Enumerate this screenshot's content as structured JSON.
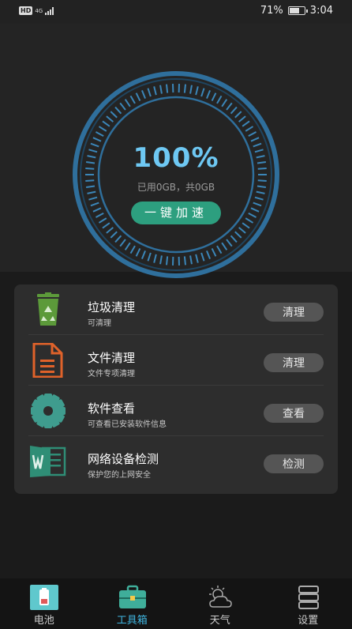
{
  "status_bar": {
    "hd": "HD",
    "network": "4G",
    "battery_text": "71%",
    "battery_level": 0.71,
    "time": "3:04"
  },
  "hero": {
    "percent": "100%",
    "usage": "已用0GB，共0GB",
    "boost_label": "一键加速"
  },
  "tools": [
    {
      "title": "垃圾清理",
      "desc": "可清理",
      "button": "清理",
      "icon": "trash-recycle-icon",
      "color": "#5c9a3a"
    },
    {
      "title": "文件清理",
      "desc": "文件专项清理",
      "button": "清理",
      "icon": "document-icon",
      "color": "#e0622a"
    },
    {
      "title": "软件查看",
      "desc": "可查看已安装软件信息",
      "button": "查看",
      "icon": "gear-icon",
      "color": "#3f9c8e"
    },
    {
      "title": "网络设备检测",
      "desc": "保护您的上网安全",
      "button": "检测",
      "icon": "word-document-icon",
      "color": "#2f8e76"
    }
  ],
  "nav": [
    {
      "label": "电池",
      "icon": "battery-icon",
      "active": false
    },
    {
      "label": "工具箱",
      "icon": "toolbox-icon",
      "active": true
    },
    {
      "label": "天气",
      "icon": "weather-icon",
      "active": false
    },
    {
      "label": "设置",
      "icon": "settings-icon",
      "active": false
    }
  ],
  "colors": {
    "accent_blue": "#6ec8f3",
    "accent_green": "#2d9f7f",
    "ring_blue": "#2f6f9c",
    "nav_active": "#3fb4df"
  }
}
